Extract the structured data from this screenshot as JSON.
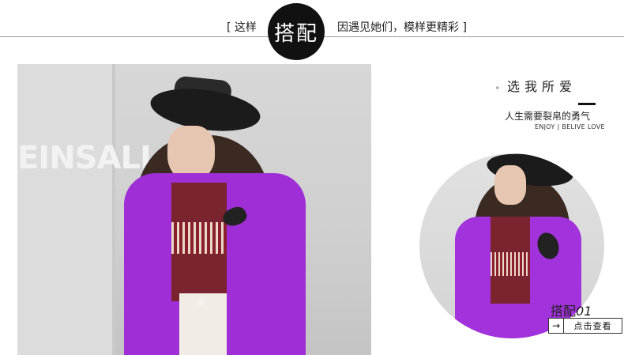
{
  "header": {
    "bracket_left": "[",
    "left_text": "这样",
    "badge_text": "搭配",
    "right_text": "因遇见她们，模样更精彩",
    "bracket_right": "]"
  },
  "left_photo": {
    "signage_text": "EINSALL"
  },
  "right_panel": {
    "title_dot": "。",
    "title": "选我所爱",
    "subtitle": "人生需要裂帛的勇气",
    "subtitle_en": "ENJOY | BELIVE LOVE"
  },
  "outfit": {
    "label": "搭配",
    "number": "01",
    "button_arrow": "→",
    "button_label": "点击查看"
  },
  "colors": {
    "coat_purple": "#9f2ed6",
    "badge_black": "#111111",
    "rule_gray": "#9a9a9a"
  }
}
